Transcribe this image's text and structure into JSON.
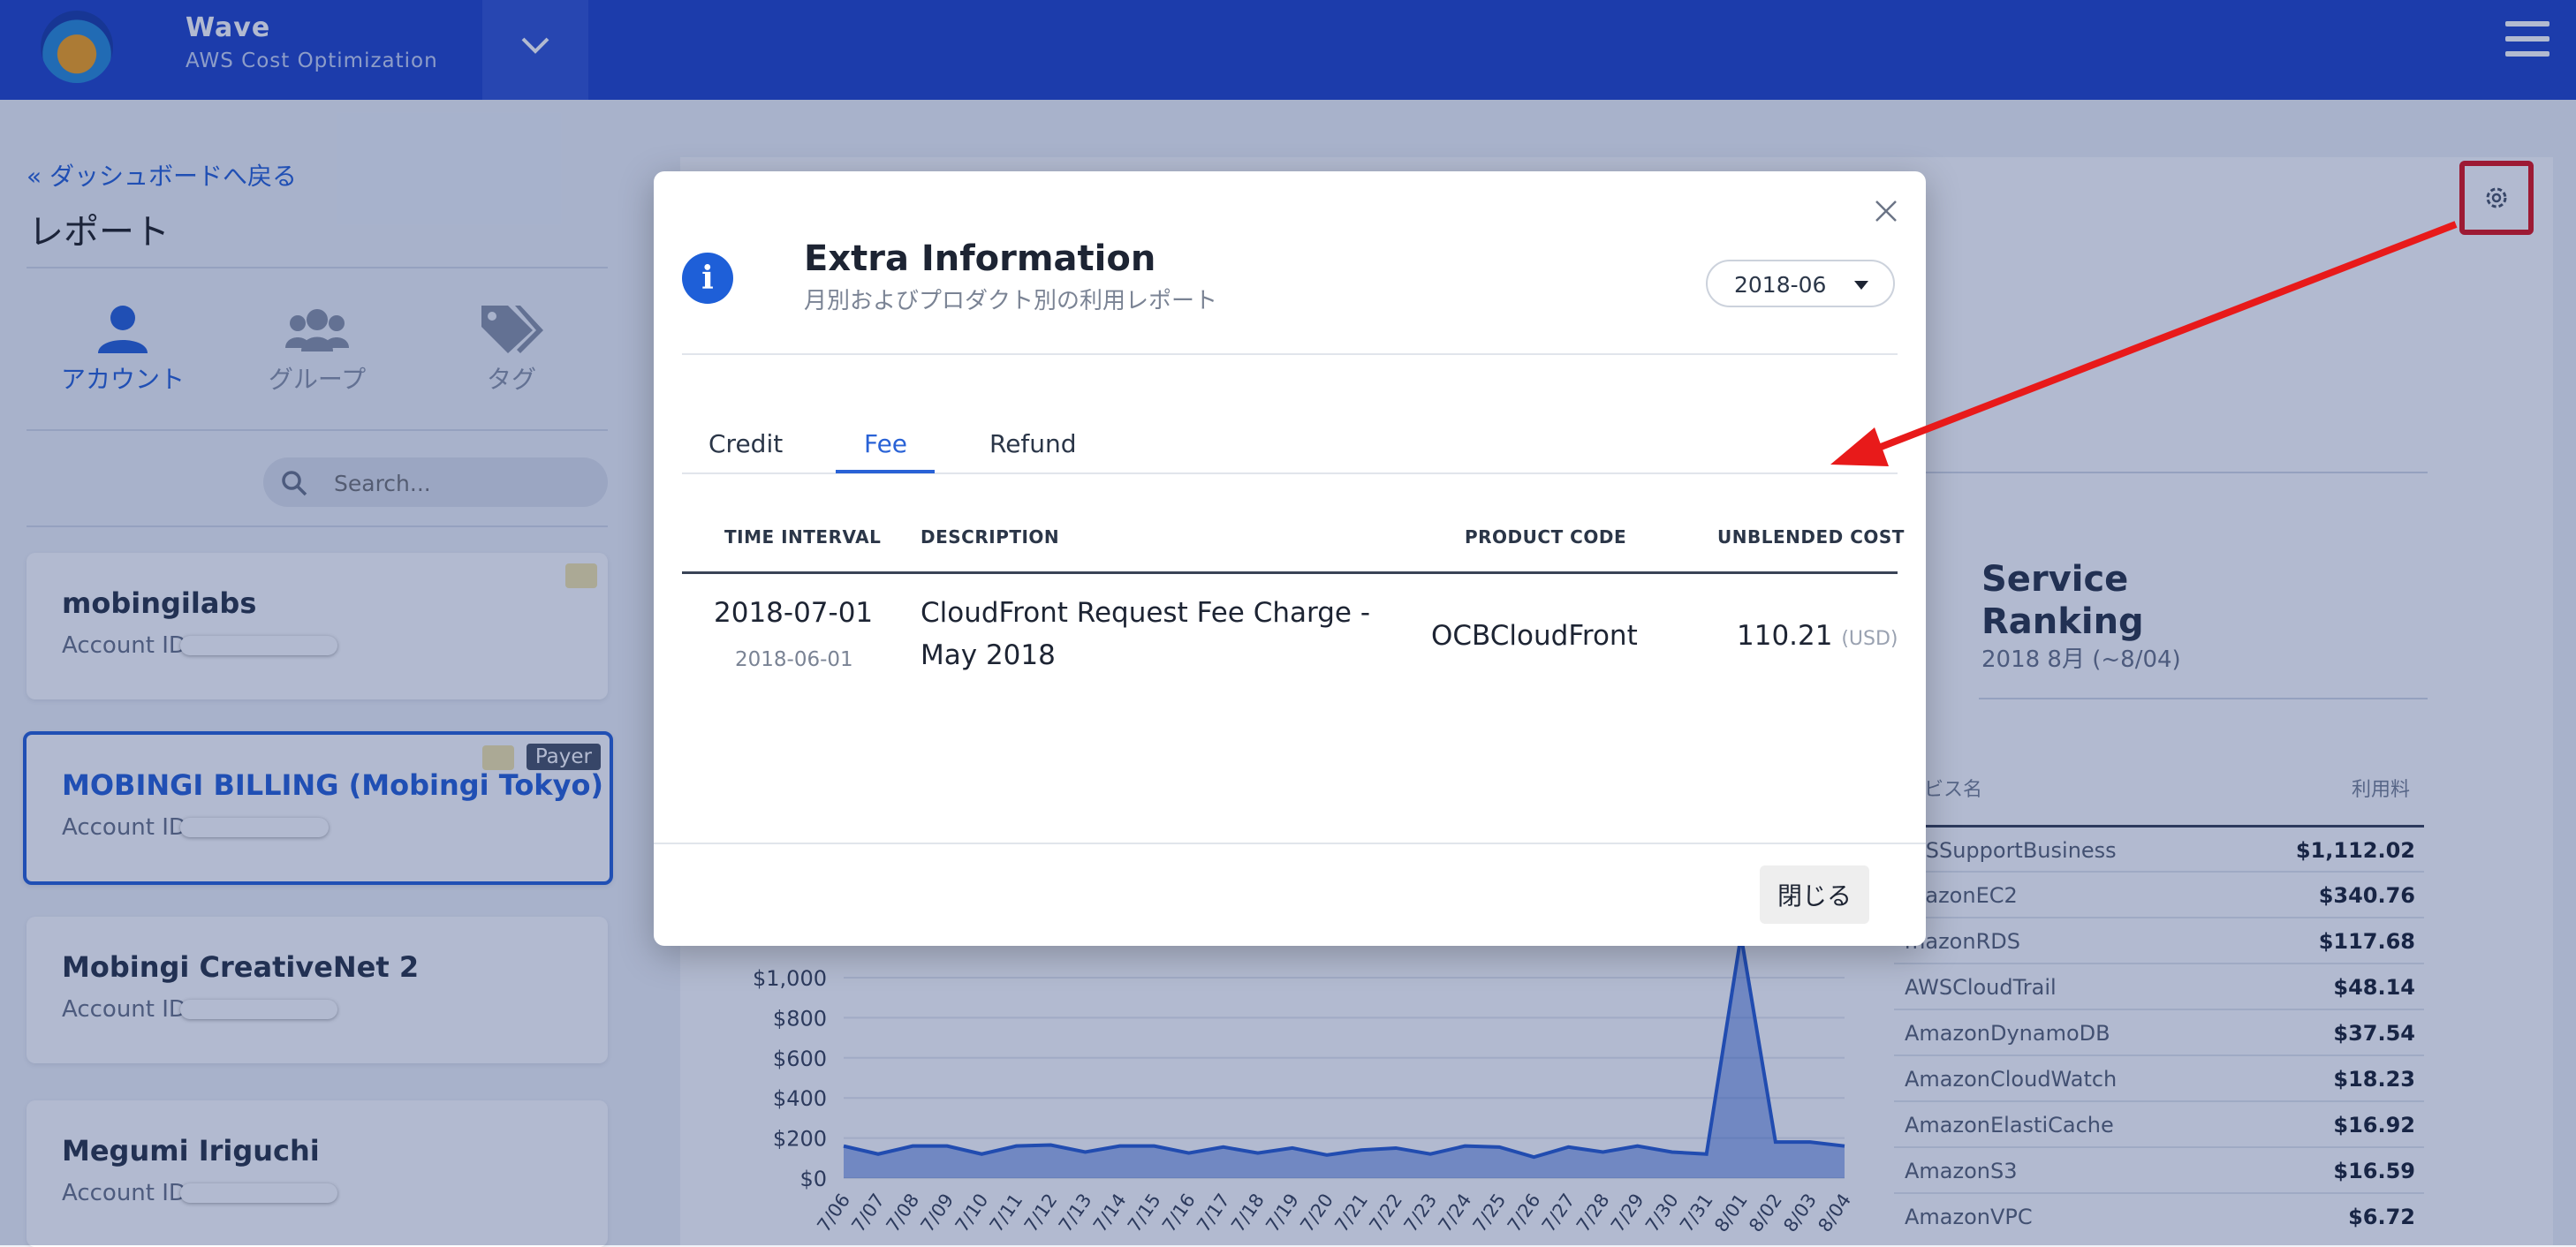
{
  "app": {
    "title": "Wave",
    "subtitle": "AWS Cost Optimization"
  },
  "sidebar": {
    "back_link": "« ダッシュボードへ戻る",
    "title": "レポート",
    "tabs": [
      {
        "label": "アカウント",
        "icon": "user-icon",
        "active": true
      },
      {
        "label": "グループ",
        "icon": "users-icon",
        "active": false
      },
      {
        "label": "タグ",
        "icon": "tags-icon",
        "active": false
      }
    ],
    "search": {
      "placeholder": "Search..."
    },
    "accounts": [
      {
        "name": "mobingilabs",
        "id_label": "Account ID:",
        "selected": false
      },
      {
        "name": "MOBINGI BILLING (Mobingi Tokyo)",
        "id_label": "Account ID:",
        "badge": "Payer",
        "selected": true
      },
      {
        "name": "Mobingi CreativeNet 2",
        "id_label": "Account ID:",
        "selected": false
      },
      {
        "name": "Megumi Iriguchi",
        "id_label": "Account ID:",
        "selected": false
      }
    ]
  },
  "service_ranking": {
    "title_line1": "Service",
    "title_line2": "Ranking",
    "subtitle": "2018 8月 (~8/04)",
    "header_name": "ービス名",
    "header_fee": "利用料",
    "rows": [
      {
        "name": "WSSupportBusiness",
        "value": "$1,112.02"
      },
      {
        "name": "mazonEC2",
        "value": "$340.76"
      },
      {
        "name": "mazonRDS",
        "value": "$117.68"
      },
      {
        "name": "AWSCloudTrail",
        "value": "$48.14"
      },
      {
        "name": "AmazonDynamoDB",
        "value": "$37.54"
      },
      {
        "name": "AmazonCloudWatch",
        "value": "$18.23"
      },
      {
        "name": "AmazonElastiCache",
        "value": "$16.92"
      },
      {
        "name": "AmazonS3",
        "value": "$16.59"
      },
      {
        "name": "AmazonVPC",
        "value": "$6.72"
      }
    ]
  },
  "chart_data": {
    "type": "area",
    "x": [
      "7/06",
      "7/07",
      "7/08",
      "7/09",
      "7/10",
      "7/11",
      "7/12",
      "7/13",
      "7/14",
      "7/15",
      "7/16",
      "7/17",
      "7/18",
      "7/19",
      "7/20",
      "7/21",
      "7/22",
      "7/23",
      "7/24",
      "7/25",
      "7/26",
      "7/27",
      "7/28",
      "7/29",
      "7/30",
      "7/31",
      "8/01",
      "8/02",
      "8/03",
      "8/04"
    ],
    "series": [
      {
        "values": [
          160,
          120,
          160,
          160,
          120,
          160,
          165,
          130,
          160,
          160,
          125,
          155,
          125,
          150,
          115,
          140,
          150,
          120,
          160,
          155,
          105,
          155,
          130,
          160,
          130,
          120,
          1210,
          180,
          180,
          160
        ]
      }
    ],
    "y_ticks": [
      "$0",
      "$200",
      "$400",
      "$600",
      "$800",
      "$1,000"
    ],
    "ylim": [
      0,
      1200
    ],
    "color": "#2a5dd0",
    "xlabel": "",
    "ylabel": ""
  },
  "modal": {
    "title": "Extra Information",
    "subtitle": "月別およびプロダクト別の利用レポート",
    "month": "2018-06",
    "tabs": [
      "Credit",
      "Fee",
      "Refund"
    ],
    "active_tab": "Fee",
    "columns": [
      "TIME INTERVAL",
      "DESCRIPTION",
      "PRODUCT CODE",
      "UNBLENDED COST"
    ],
    "rows": [
      {
        "time_start": "2018-07-01",
        "time_end": "2018-06-01",
        "description_line1": "CloudFront Request Fee Charge -",
        "description_line2": "May 2018",
        "product_code": "OCBCloudFront",
        "cost": "110.21",
        "currency": "(USD)"
      }
    ],
    "close_label": "閉じる"
  },
  "colors": {
    "primary": "#2346c9",
    "accent": "#2962d6",
    "highlight": "#e0141a"
  }
}
